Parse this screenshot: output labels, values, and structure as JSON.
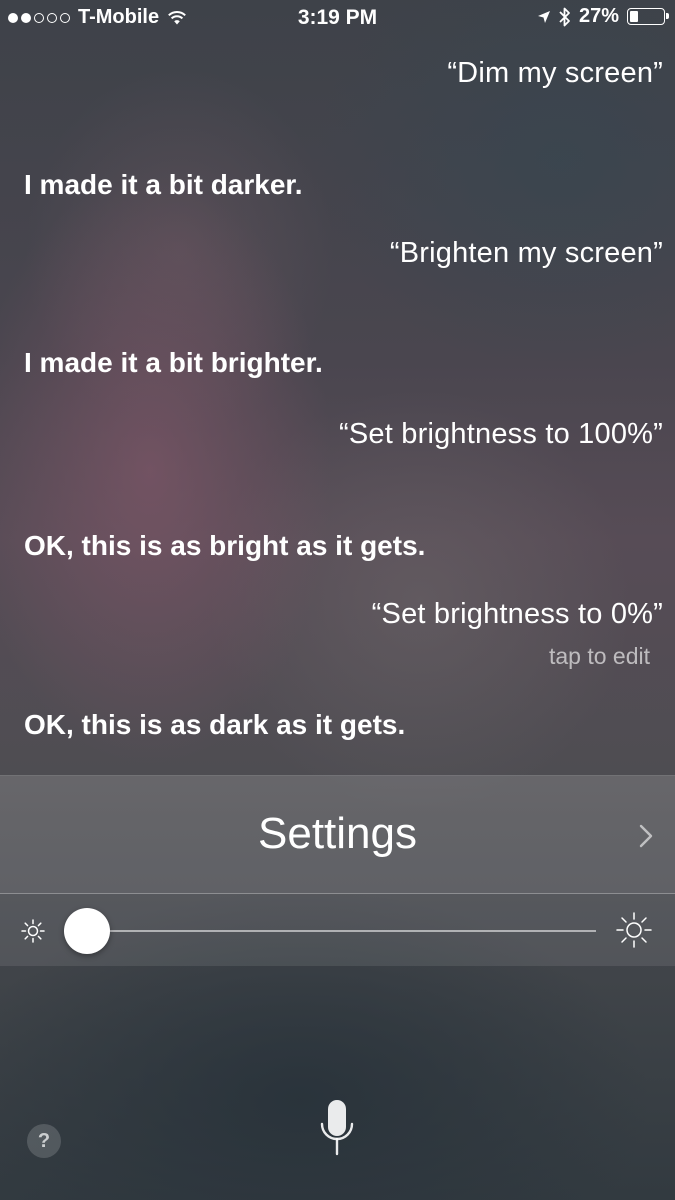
{
  "status_bar": {
    "signal_bars_filled": 2,
    "signal_bars_total": 5,
    "carrier": "T-Mobile",
    "wifi_icon": "wifi-icon",
    "time": "3:19 PM",
    "location_icon": "location-arrow-icon",
    "bluetooth_icon": "bluetooth-icon",
    "battery_percent_text": "27%",
    "battery_level": 0.27
  },
  "conversation": {
    "user_1": "“Dim my screen”",
    "siri_1": "I made it a bit darker.",
    "user_2": "“Brighten my screen”",
    "siri_2": "I made it a bit brighter.",
    "user_3": "“Set brightness to 100%”",
    "siri_3": "OK, this is as bright as it gets.",
    "user_4": "“Set brightness to 0%”",
    "tap_to_edit": "tap to edit",
    "siri_4": "OK, this is as dark as it gets."
  },
  "settings_card": {
    "title": "Settings",
    "chevron_icon": "chevron-right-icon"
  },
  "brightness_slider": {
    "value": 0.0,
    "min_icon": "sun-small-icon",
    "max_icon": "sun-large-icon"
  },
  "bottom_bar": {
    "help_label": "?",
    "mic_icon": "microphone-icon"
  },
  "colors": {
    "text": "#ffffff",
    "muted_text": "#9fa0a6"
  }
}
